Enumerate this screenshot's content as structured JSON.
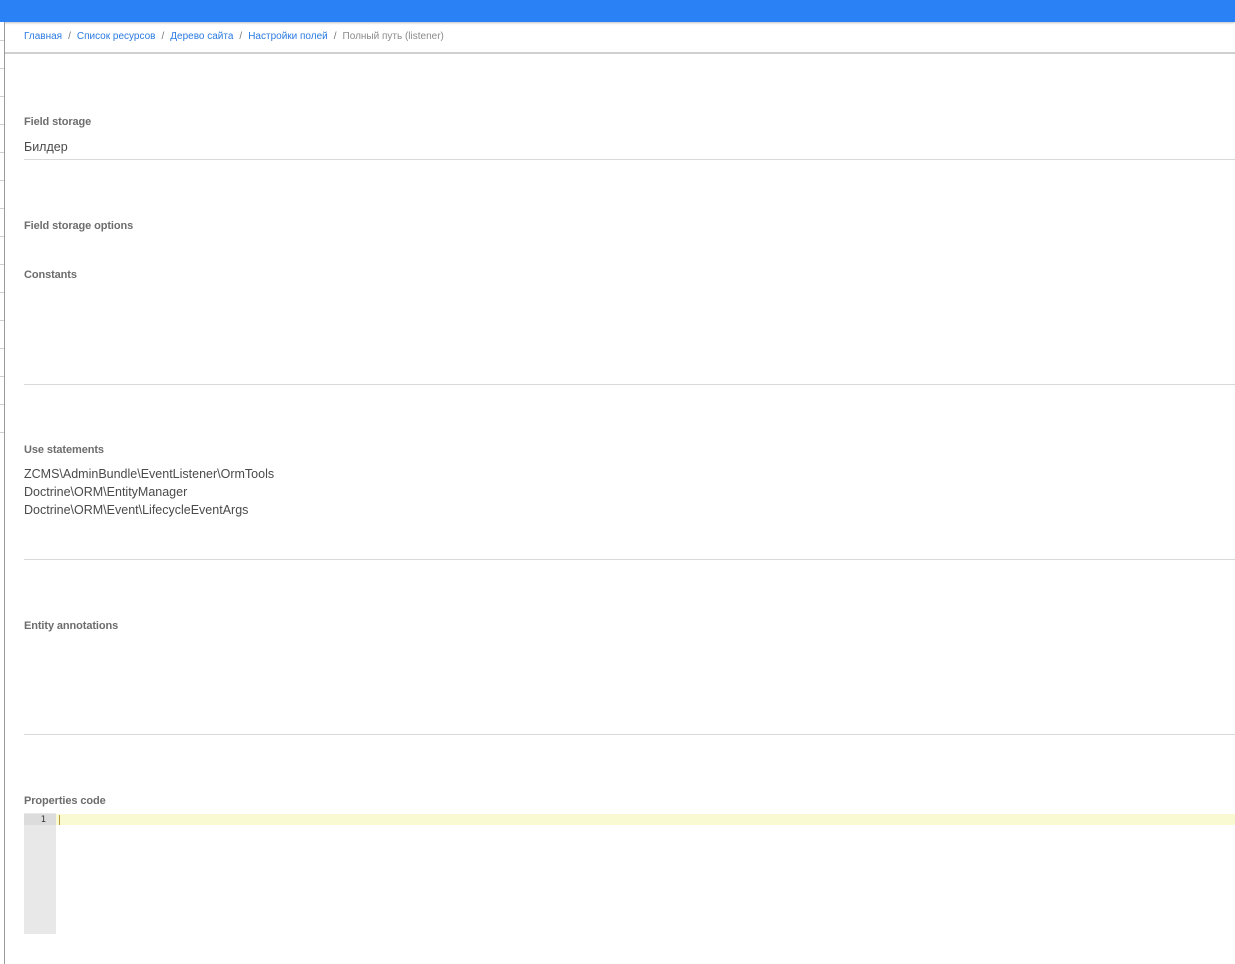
{
  "breadcrumb": {
    "items": [
      "Главная",
      "Список ресурсов",
      "Дерево сайта",
      "Настройки полей"
    ],
    "separator": "/",
    "current": "Полный путь (listener)"
  },
  "fields": {
    "field_storage": {
      "label": "Field storage",
      "value": "Билдер"
    },
    "field_storage_options": {
      "label": "Field storage options"
    },
    "constants": {
      "label": "Constants",
      "value": ""
    },
    "use_statements": {
      "label": "Use statements",
      "items": [
        "ZCMS\\AdminBundle\\EventListener\\OrmTools",
        "Doctrine\\ORM\\EntityManager",
        "Doctrine\\ORM\\Event\\LifecycleEventArgs"
      ]
    },
    "entity_annotations": {
      "label": "Entity annotations",
      "value": ""
    },
    "properties_code": {
      "label": "Properties code",
      "line_number": "1",
      "code": ""
    }
  },
  "colors": {
    "topbar": "#2a80f5",
    "link": "#2a7ae2",
    "active_line": "#fafad2"
  }
}
